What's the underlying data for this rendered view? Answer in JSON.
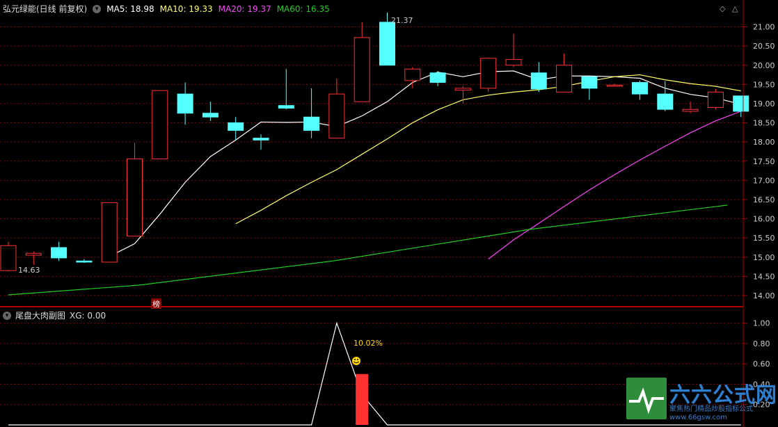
{
  "header": {
    "stock_title": "弘元绿能(日线 前复权)",
    "ma5_label": "MA5: 18.98",
    "ma10_label": "MA10: 19.33",
    "ma20_label": "MA20: 19.37",
    "ma60_label": "MA60: 16.35"
  },
  "subheader": {
    "indicator_title": "尾盘大肉副图",
    "xg_label": "XG: 0.00"
  },
  "badge": {
    "label": "榜"
  },
  "watermark": {
    "title": "六六公式网",
    "slogan": "聚焦热门精品炒股指标公式",
    "url": "www.66gsw.com"
  },
  "colors": {
    "up": "#ff3232",
    "down": "#54ffff",
    "ma5": "#ffffff",
    "ma10": "#ffff66",
    "ma20": "#ff44ff",
    "ma60": "#22cc22",
    "axis": "#b00000"
  },
  "chart_data": [
    {
      "type": "candlestick",
      "title": "弘元绿能(日线 前复权)",
      "ylim": [
        13.8,
        21.3
      ],
      "y_ticks": [
        "21.00",
        "20.50",
        "20.00",
        "19.50",
        "19.00",
        "18.50",
        "18.00",
        "17.50",
        "17.00",
        "16.50",
        "16.00",
        "15.50",
        "15.00",
        "14.50",
        "14.00"
      ],
      "annotations": {
        "high_label": "21.37",
        "low_label": "14.63"
      },
      "candles": [
        {
          "o": 14.65,
          "h": 15.4,
          "l": 14.63,
          "c": 15.3
        },
        {
          "o": 15.05,
          "h": 15.15,
          "l": 14.8,
          "c": 15.1
        },
        {
          "o": 15.25,
          "h": 15.4,
          "l": 14.9,
          "c": 14.98
        },
        {
          "o": 14.9,
          "h": 14.95,
          "l": 14.85,
          "c": 14.87
        },
        {
          "o": 14.87,
          "h": 16.42,
          "l": 14.87,
          "c": 16.42
        },
        {
          "o": 15.55,
          "h": 17.98,
          "l": 15.55,
          "c": 17.56
        },
        {
          "o": 17.56,
          "h": 19.34,
          "l": 17.56,
          "c": 19.34
        },
        {
          "o": 19.25,
          "h": 19.55,
          "l": 18.45,
          "c": 18.75
        },
        {
          "o": 18.75,
          "h": 19.05,
          "l": 18.55,
          "c": 18.65
        },
        {
          "o": 18.5,
          "h": 18.65,
          "l": 18.05,
          "c": 18.3
        },
        {
          "o": 18.1,
          "h": 18.2,
          "l": 17.8,
          "c": 18.05
        },
        {
          "o": 18.95,
          "h": 19.9,
          "l": 18.85,
          "c": 18.88
        },
        {
          "o": 18.65,
          "h": 19.4,
          "l": 18.1,
          "c": 18.3
        },
        {
          "o": 18.1,
          "h": 19.65,
          "l": 18.1,
          "c": 19.25
        },
        {
          "o": 19.05,
          "h": 21.12,
          "l": 19.05,
          "c": 20.72
        },
        {
          "o": 21.12,
          "h": 21.37,
          "l": 20.0,
          "c": 20.0
        },
        {
          "o": 19.6,
          "h": 19.95,
          "l": 19.4,
          "c": 19.9
        },
        {
          "o": 19.8,
          "h": 19.85,
          "l": 19.45,
          "c": 19.55
        },
        {
          "o": 19.35,
          "h": 19.45,
          "l": 19.0,
          "c": 19.4
        },
        {
          "o": 19.4,
          "h": 20.2,
          "l": 19.3,
          "c": 20.18
        },
        {
          "o": 20.0,
          "h": 20.82,
          "l": 19.95,
          "c": 20.15
        },
        {
          "o": 19.8,
          "h": 20.08,
          "l": 19.3,
          "c": 19.38
        },
        {
          "o": 19.3,
          "h": 20.3,
          "l": 19.3,
          "c": 20.0
        },
        {
          "o": 19.7,
          "h": 19.7,
          "l": 19.1,
          "c": 19.4
        },
        {
          "o": 19.45,
          "h": 19.52,
          "l": 19.45,
          "c": 19.48
        },
        {
          "o": 19.55,
          "h": 19.6,
          "l": 19.1,
          "c": 19.25
        },
        {
          "o": 19.25,
          "h": 19.58,
          "l": 18.8,
          "c": 18.85
        },
        {
          "o": 18.8,
          "h": 19.05,
          "l": 18.75,
          "c": 18.85
        },
        {
          "o": 18.9,
          "h": 19.38,
          "l": 18.85,
          "c": 19.3
        },
        {
          "o": 19.2,
          "h": 19.2,
          "l": 18.65,
          "c": 18.8
        }
      ],
      "series": [
        {
          "name": "MA5",
          "values": [
            null,
            null,
            null,
            null,
            15.02,
            15.35,
            16.12,
            16.95,
            17.62,
            18.05,
            18.52,
            18.51,
            18.52,
            18.4,
            18.68,
            19.05,
            19.55,
            19.82,
            19.7,
            19.83,
            19.85,
            19.62,
            19.72,
            19.72,
            19.7,
            19.66,
            19.4,
            19.24,
            19.15,
            18.98
          ]
        },
        {
          "name": "MA10",
          "values": [
            null,
            null,
            null,
            null,
            null,
            null,
            null,
            null,
            null,
            15.87,
            16.22,
            16.6,
            16.95,
            17.28,
            17.68,
            18.08,
            18.5,
            18.84,
            19.1,
            19.22,
            19.3,
            19.36,
            19.45,
            19.58,
            19.7,
            19.75,
            19.62,
            19.52,
            19.45,
            19.33
          ]
        },
        {
          "name": "MA20",
          "values": [
            null,
            null,
            null,
            null,
            null,
            null,
            null,
            null,
            null,
            null,
            null,
            null,
            null,
            null,
            null,
            null,
            null,
            null,
            null,
            14.95,
            15.45,
            15.88,
            16.32,
            16.75,
            17.15,
            17.53,
            17.89,
            18.24,
            18.55,
            18.8
          ]
        },
        {
          "name": "MA60",
          "values": [
            null,
            null,
            null,
            null,
            null,
            null,
            null,
            null,
            null,
            null,
            null,
            null,
            null,
            null,
            null,
            null,
            null,
            null,
            null,
            null,
            null,
            null,
            null,
            null,
            null,
            null,
            null,
            null,
            null,
            null
          ]
        }
      ]
    },
    {
      "type": "line",
      "title": "尾盘大肉副图",
      "ylim": [
        0,
        1.1
      ],
      "y_ticks": [
        "1.00",
        "0.80",
        "0.60",
        "0.40",
        "0.20"
      ],
      "signal_values": [
        0,
        0,
        0,
        0,
        0,
        0,
        0,
        0,
        0,
        0,
        0,
        0,
        0,
        1,
        0.3,
        0,
        0,
        0,
        0,
        0,
        0,
        0,
        0,
        0,
        0,
        0,
        0,
        0,
        0,
        0
      ],
      "bar_index": 14,
      "bar_value": 0.5,
      "annotation": "10.02%"
    }
  ]
}
